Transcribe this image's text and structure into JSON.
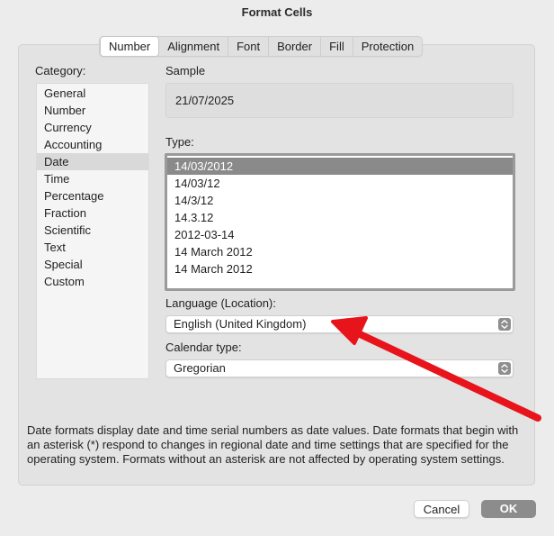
{
  "window": {
    "title": "Format Cells"
  },
  "tabs": [
    {
      "label": "Number",
      "active": true
    },
    {
      "label": "Alignment",
      "active": false
    },
    {
      "label": "Font",
      "active": false
    },
    {
      "label": "Border",
      "active": false
    },
    {
      "label": "Fill",
      "active": false
    },
    {
      "label": "Protection",
      "active": false
    }
  ],
  "category": {
    "label": "Category:",
    "items": [
      "General",
      "Number",
      "Currency",
      "Accounting",
      "Date",
      "Time",
      "Percentage",
      "Fraction",
      "Scientific",
      "Text",
      "Special",
      "Custom"
    ],
    "selected": "Date"
  },
  "sample": {
    "label": "Sample",
    "value": "21/07/2025"
  },
  "type": {
    "label": "Type:",
    "items": [
      "14/03/2012",
      "14/03/12",
      "14/3/12",
      "14.3.12",
      "2012-03-14",
      "14 March 2012",
      "14 March 2012"
    ],
    "selected_index": 0
  },
  "language": {
    "label": "Language (Location):",
    "value": "English (United Kingdom)"
  },
  "calendar": {
    "label": "Calendar type:",
    "value": "Gregorian"
  },
  "description": "Date formats display date and time serial numbers as date values.  Date formats that begin with an asterisk (*) respond to changes in regional date and time settings that are specified for the operating system. Formats without an asterisk are not affected by operating system settings.",
  "buttons": {
    "cancel": "Cancel",
    "ok": "OK"
  },
  "colors": {
    "annotation_arrow": "#e8141b",
    "selection": "#8a8a8a"
  }
}
